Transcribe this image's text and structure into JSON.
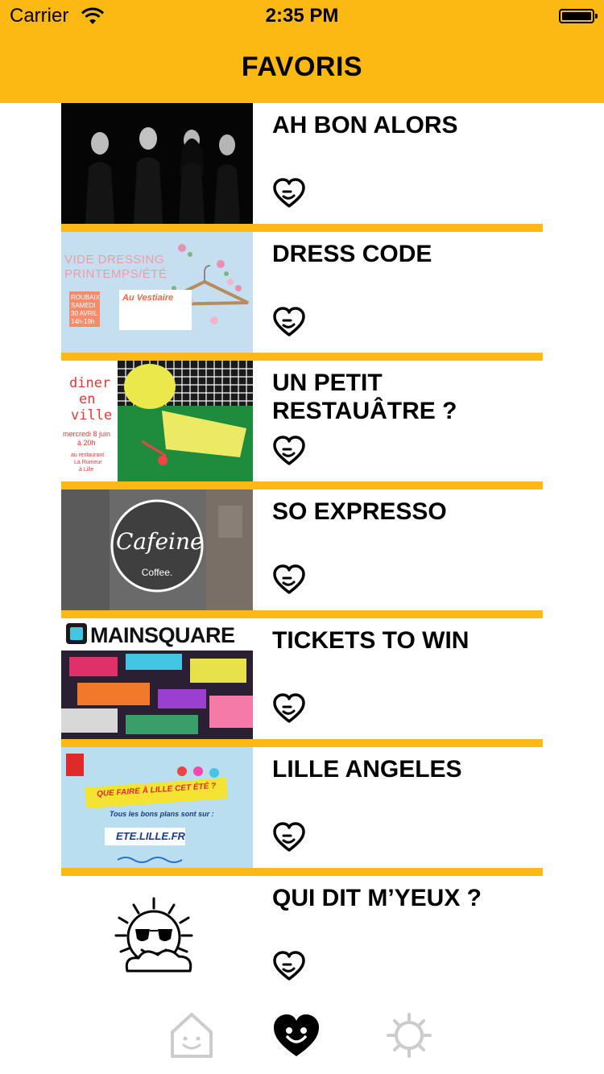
{
  "status_bar": {
    "carrier": "Carrier",
    "time": "2:35 PM"
  },
  "nav": {
    "title": "FAVORIS"
  },
  "items": [
    {
      "title": "AH BON ALORS",
      "image": "band-photo"
    },
    {
      "title": "DRESS CODE",
      "image": "vide-dressing-poster",
      "image_text": {
        "line1": "VIDE DRESSING",
        "line2": "PRINTEMPS/ÉTÉ",
        "tag1": "ROUBAIX",
        "tag2": "SAMEDI",
        "tag3": "30 AVRIL",
        "tag4": "14h-19h",
        "brand": "Au Vestiaire"
      }
    },
    {
      "title": "UN PETIT RESTAUÂTRE ?",
      "image": "diner-en-ville-poster",
      "image_text": {
        "line1": "diner",
        "line2": "en",
        "line3": "ville",
        "date1": "mercredi 8 juin",
        "date2": "à 20h",
        "venue1": "au restaurant",
        "venue2": "La Rumeur",
        "venue3": "à Lille"
      }
    },
    {
      "title": "SO EXPRESSO",
      "image": "cafeine-coffee-sign",
      "image_text": {
        "logo": "Cafeine",
        "sub": "Coffee."
      }
    },
    {
      "title": "TICKETS TO WIN",
      "image": "mainsquare-poster",
      "image_text": {
        "logo": "MAINSQUARE"
      }
    },
    {
      "title": "LILLE ANGELES",
      "image": "lille-ete-poster",
      "image_text": {
        "line1": "QUE FAIRE À LILLE CET ÉTÉ ?",
        "line2": "Tous les bons plans sont sur :",
        "url": "ETE.LILLE.FR"
      }
    },
    {
      "title": "QUI DIT M’YEUX ?",
      "image": "sun-sunglasses-icon"
    }
  ],
  "tabs": [
    {
      "name": "home",
      "active": false
    },
    {
      "name": "favorites",
      "active": true
    },
    {
      "name": "settings",
      "active": false
    }
  ],
  "colors": {
    "accent": "#FDB913",
    "text": "#000000",
    "tab_inactive": "#cccccc"
  }
}
